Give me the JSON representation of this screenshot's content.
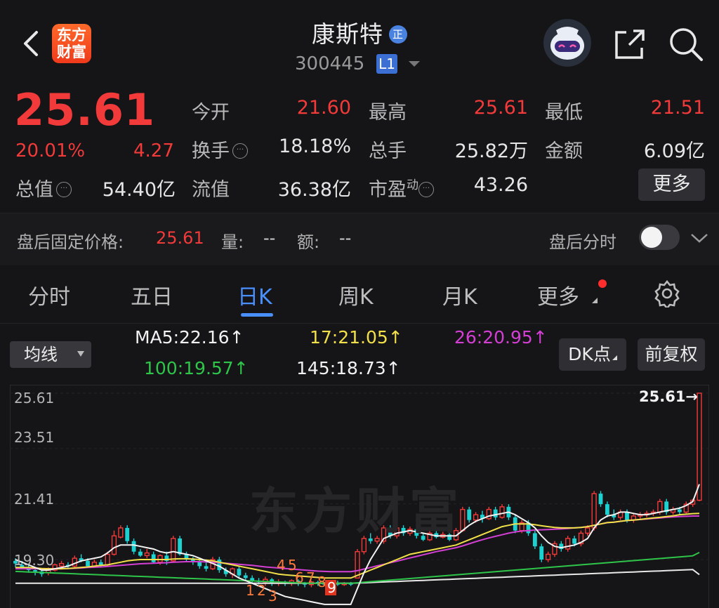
{
  "header": {
    "logo_line1": "东方",
    "logo_line2": "财富",
    "stock_name": "康斯特",
    "badge": "正",
    "code": "300445",
    "level": "L1"
  },
  "quote": {
    "price": "25.61",
    "change_pct": "20.01%",
    "change": "4.27",
    "fields": [
      {
        "label": "今开",
        "value": "21.60",
        "red": true
      },
      {
        "label": "最高",
        "value": "25.61",
        "red": true
      },
      {
        "label": "最低",
        "value": "21.51",
        "red": true
      },
      {
        "label": "换手",
        "value": "18.18%",
        "red": false
      },
      {
        "label": "总手",
        "value": "25.82万",
        "red": false
      },
      {
        "label": "金额",
        "value": "6.09亿",
        "red": false
      },
      {
        "label": "总值",
        "value": "54.40亿",
        "red": false
      },
      {
        "label": "流值",
        "value": "36.38亿",
        "red": false
      },
      {
        "label": "市盈",
        "value": "43.26",
        "red": false
      }
    ],
    "pe_sup": "动",
    "more_label": "更多"
  },
  "afterhours": {
    "fixed_price_label": "盘后固定价格:",
    "fixed_price": "25.61",
    "vol_label": "量:",
    "vol": "--",
    "amt_label": "额:",
    "amt": "--",
    "toggle_label": "盘后分时"
  },
  "tabs": [
    "分时",
    "五日",
    "日K",
    "周K",
    "月K",
    "更多"
  ],
  "active_tab": "日K",
  "ma": {
    "select_label": "均线",
    "items": [
      {
        "text": "MA5:22.16↑",
        "color": "#f2f2f2"
      },
      {
        "text": "17:21.05↑",
        "color": "#f2e04a"
      },
      {
        "text": "26:20.95↑",
        "color": "#d33fd3"
      },
      {
        "text": "100:19.57↑",
        "color": "#2fc44a"
      },
      {
        "text": "145:18.73↑",
        "color": "#f2f2f2"
      }
    ],
    "dk_label": "DK点",
    "fq_label": "前复权"
  },
  "chart_data": {
    "type": "candlestick",
    "y_ticks": [
      "25.61",
      "23.51",
      "21.41",
      "19.30"
    ],
    "ylim": [
      18.6,
      25.61
    ],
    "last_price_label": "25.61→",
    "watermark": "东方财富",
    "signal_numbers": [
      "4",
      "5",
      "1",
      "2",
      "3",
      "6",
      "7",
      "8",
      "9"
    ],
    "colors": {
      "up": "#f23a3a",
      "down": "#1ed1d1",
      "ma5": "#f2f2f2",
      "ma17": "#f2e04a",
      "ma26": "#d33fd3",
      "ma100": "#2fc44a",
      "ma145": "#e8e8e8"
    },
    "candles": [
      [
        19.25,
        19.15,
        19.35,
        19.0
      ],
      [
        19.1,
        19.0,
        19.25,
        18.95
      ],
      [
        19.0,
        18.9,
        19.1,
        18.8
      ],
      [
        18.9,
        18.85,
        19.0,
        18.7
      ],
      [
        18.85,
        18.75,
        18.95,
        18.65
      ],
      [
        18.8,
        18.9,
        19.0,
        18.7
      ],
      [
        18.9,
        19.1,
        19.15,
        18.85
      ],
      [
        19.05,
        19.15,
        19.25,
        18.95
      ],
      [
        19.1,
        19.05,
        19.2,
        18.95
      ],
      [
        19.05,
        19.35,
        19.45,
        19.0
      ],
      [
        19.35,
        19.25,
        19.5,
        19.2
      ],
      [
        19.25,
        19.05,
        19.35,
        19.0
      ],
      [
        19.05,
        19.2,
        19.3,
        19.0
      ],
      [
        19.2,
        19.1,
        19.3,
        19.0
      ],
      [
        19.1,
        19.5,
        19.6,
        19.05
      ],
      [
        19.5,
        20.2,
        20.4,
        19.45
      ],
      [
        20.15,
        20.5,
        20.6,
        20.1
      ],
      [
        20.5,
        20.0,
        20.6,
        19.9
      ],
      [
        20.0,
        19.6,
        20.1,
        19.5
      ],
      [
        19.6,
        19.45,
        19.7,
        19.4
      ],
      [
        19.45,
        19.55,
        19.7,
        19.35
      ],
      [
        19.5,
        19.2,
        19.6,
        19.15
      ],
      [
        19.2,
        19.45,
        19.5,
        19.1
      ],
      [
        19.45,
        19.25,
        19.6,
        19.1
      ],
      [
        19.25,
        20.1,
        20.2,
        19.2
      ],
      [
        20.1,
        19.5,
        20.2,
        19.45
      ],
      [
        19.5,
        19.3,
        19.6,
        19.2
      ],
      [
        19.3,
        19.25,
        19.4,
        19.1
      ],
      [
        19.25,
        19.05,
        19.35,
        18.95
      ],
      [
        19.05,
        18.95,
        19.2,
        18.85
      ],
      [
        18.95,
        19.3,
        19.4,
        18.9
      ],
      [
        19.3,
        18.9,
        19.4,
        18.8
      ],
      [
        18.9,
        18.75,
        19.0,
        18.65
      ],
      [
        18.75,
        18.95,
        19.0,
        18.6
      ],
      [
        18.95,
        18.7,
        19.05,
        18.6
      ],
      [
        18.7,
        18.6,
        18.8,
        18.5
      ],
      [
        18.6,
        18.5,
        18.7,
        18.4
      ],
      [
        18.5,
        18.45,
        18.6,
        18.35
      ],
      [
        18.45,
        18.55,
        18.65,
        18.3
      ],
      [
        18.55,
        18.4,
        18.6,
        18.3
      ],
      [
        18.4,
        18.45,
        18.55,
        18.3
      ],
      [
        18.45,
        18.4,
        18.5,
        18.3
      ],
      [
        18.4,
        18.5,
        18.55,
        18.3
      ],
      [
        18.5,
        18.4,
        18.55,
        18.3
      ],
      [
        18.4,
        18.35,
        18.45,
        18.25
      ],
      [
        18.35,
        18.45,
        18.5,
        18.25
      ],
      [
        18.45,
        18.4,
        18.5,
        18.3
      ],
      [
        18.4,
        18.35,
        18.45,
        18.3
      ],
      [
        18.35,
        18.4,
        18.45,
        18.3
      ],
      [
        18.4,
        18.35,
        18.5,
        18.3
      ],
      [
        18.35,
        18.4,
        18.45,
        18.3
      ],
      [
        18.4,
        18.35,
        18.45,
        18.3
      ],
      [
        18.6,
        19.6,
        19.7,
        18.6
      ],
      [
        19.6,
        20.1,
        20.2,
        19.5
      ],
      [
        20.1,
        20.0,
        20.3,
        19.9
      ],
      [
        20.0,
        20.1,
        20.2,
        19.9
      ],
      [
        20.0,
        20.5,
        20.6,
        19.9
      ],
      [
        20.5,
        20.2,
        20.6,
        20.1
      ],
      [
        20.2,
        20.5,
        20.6,
        20.1
      ],
      [
        20.5,
        20.3,
        20.6,
        20.2
      ],
      [
        20.3,
        20.45,
        20.55,
        20.2
      ],
      [
        20.45,
        20.2,
        20.5,
        20.1
      ],
      [
        20.2,
        20.05,
        20.3,
        20.0
      ],
      [
        20.05,
        20.3,
        20.4,
        20.0
      ],
      [
        20.3,
        20.15,
        20.4,
        20.1
      ],
      [
        20.15,
        20.25,
        20.35,
        20.1
      ],
      [
        20.25,
        20.05,
        20.3,
        20.0
      ],
      [
        20.05,
        20.4,
        20.5,
        20.0
      ],
      [
        20.4,
        21.2,
        21.3,
        20.35
      ],
      [
        21.2,
        20.8,
        21.3,
        20.7
      ],
      [
        20.8,
        21.0,
        21.1,
        20.7
      ],
      [
        21.0,
        20.85,
        21.15,
        20.7
      ],
      [
        20.85,
        21.2,
        21.3,
        20.8
      ],
      [
        21.2,
        20.9,
        21.3,
        20.8
      ],
      [
        20.9,
        21.3,
        21.4,
        20.85
      ],
      [
        21.3,
        20.9,
        21.4,
        20.8
      ],
      [
        20.9,
        20.4,
        21.0,
        20.3
      ],
      [
        20.4,
        20.7,
        20.8,
        20.3
      ],
      [
        20.7,
        20.3,
        20.8,
        20.2
      ],
      [
        20.3,
        19.8,
        20.4,
        19.7
      ],
      [
        19.8,
        19.3,
        19.9,
        19.2
      ],
      [
        19.3,
        19.5,
        19.6,
        19.2
      ],
      [
        19.5,
        19.9,
        20.0,
        19.4
      ],
      [
        19.9,
        19.7,
        20.0,
        19.6
      ],
      [
        19.7,
        20.1,
        20.2,
        19.6
      ],
      [
        20.1,
        19.9,
        20.2,
        19.8
      ],
      [
        19.9,
        20.3,
        20.4,
        19.8
      ],
      [
        20.3,
        20.5,
        20.6,
        20.2
      ],
      [
        20.5,
        21.8,
        21.9,
        20.4
      ],
      [
        21.8,
        21.4,
        21.9,
        21.3
      ],
      [
        21.4,
        21.0,
        21.5,
        20.9
      ],
      [
        21.0,
        20.9,
        21.2,
        20.8
      ],
      [
        20.9,
        21.1,
        21.2,
        20.8
      ],
      [
        21.1,
        20.8,
        21.2,
        20.7
      ],
      [
        20.8,
        20.95,
        21.05,
        20.7
      ],
      [
        20.95,
        21.0,
        21.1,
        20.85
      ],
      [
        21.0,
        21.05,
        21.15,
        20.9
      ],
      [
        21.05,
        21.1,
        21.2,
        20.95
      ],
      [
        21.1,
        21.5,
        21.6,
        21.0
      ],
      [
        21.5,
        21.1,
        21.6,
        21.0
      ],
      [
        21.1,
        21.2,
        21.3,
        21.0
      ],
      [
        21.2,
        21.1,
        21.3,
        21.0
      ],
      [
        21.1,
        21.4,
        21.5,
        21.05
      ],
      [
        21.4,
        21.55,
        21.6,
        21.3
      ],
      [
        21.55,
        25.61,
        25.61,
        21.51
      ]
    ],
    "ma5": [
      19.3,
      19.2,
      19.1,
      19.0,
      18.9,
      18.9,
      18.95,
      19.0,
      19.05,
      19.15,
      19.25,
      19.3,
      19.35,
      19.4,
      19.55,
      19.75,
      19.85,
      19.85,
      19.85,
      19.8,
      19.75,
      19.7,
      19.6,
      19.55,
      19.6,
      19.55,
      19.5,
      19.45,
      19.35,
      19.25,
      19.15,
      19.05,
      18.9,
      18.75,
      18.6,
      18.5,
      18.4,
      18.3,
      18.2,
      18.1,
      18.0,
      17.9,
      17.85,
      17.8,
      17.75,
      17.7,
      17.65,
      17.6,
      17.6,
      17.6,
      17.6,
      17.6,
      18.2,
      18.8,
      19.3,
      19.7,
      20.1,
      20.2,
      20.3,
      20.35,
      20.4,
      20.35,
      20.3,
      20.25,
      20.2,
      20.2,
      20.2,
      20.2,
      20.4,
      20.6,
      20.75,
      20.85,
      20.95,
      21.0,
      21.05,
      21.1,
      21.0,
      20.85,
      20.7,
      20.5,
      20.2,
      19.95,
      19.8,
      19.75,
      19.8,
      19.85,
      19.95,
      20.1,
      20.5,
      20.8,
      20.95,
      21.0,
      21.1,
      21.1,
      21.05,
      21.0,
      21.0,
      21.05,
      21.1,
      21.15,
      21.2,
      21.25,
      21.35,
      21.5,
      22.16
    ],
    "ma17": [
      19.0,
      19.0,
      19.0,
      18.98,
      18.96,
      18.95,
      18.95,
      18.95,
      18.96,
      18.98,
      19.0,
      19.02,
      19.05,
      19.08,
      19.1,
      19.15,
      19.2,
      19.25,
      19.28,
      19.3,
      19.3,
      19.3,
      19.3,
      19.3,
      19.32,
      19.33,
      19.33,
      19.32,
      19.3,
      19.28,
      19.25,
      19.2,
      19.15,
      19.1,
      19.05,
      19.0,
      18.95,
      18.9,
      18.85,
      18.8,
      18.75,
      18.72,
      18.7,
      18.68,
      18.66,
      18.64,
      18.62,
      18.6,
      18.6,
      18.6,
      18.6,
      18.6,
      18.7,
      18.8,
      18.9,
      19.0,
      19.1,
      19.2,
      19.3,
      19.4,
      19.5,
      19.55,
      19.6,
      19.65,
      19.7,
      19.75,
      19.8,
      19.85,
      19.95,
      20.05,
      20.15,
      20.25,
      20.35,
      20.45,
      20.55,
      20.6,
      20.65,
      20.65,
      20.65,
      20.62,
      20.58,
      20.55,
      20.52,
      20.5,
      20.5,
      20.5,
      20.52,
      20.55,
      20.6,
      20.65,
      20.7,
      20.72,
      20.75,
      20.78,
      20.8,
      20.82,
      20.85,
      20.88,
      20.9,
      20.93,
      20.96,
      21.0,
      21.02,
      21.04,
      21.05
    ],
    "ma26": [
      18.95,
      18.95,
      18.95,
      18.95,
      18.95,
      18.95,
      18.95,
      18.95,
      18.96,
      18.97,
      18.98,
      19.0,
      19.01,
      19.02,
      19.04,
      19.06,
      19.08,
      19.1,
      19.12,
      19.14,
      19.15,
      19.16,
      19.17,
      19.18,
      19.2,
      19.21,
      19.22,
      19.22,
      19.22,
      19.21,
      19.2,
      19.18,
      19.16,
      19.14,
      19.12,
      19.1,
      19.08,
      19.05,
      19.02,
      19.0,
      18.98,
      18.96,
      18.94,
      18.92,
      18.9,
      18.88,
      18.86,
      18.85,
      18.84,
      18.84,
      18.84,
      18.84,
      18.88,
      18.94,
      19.0,
      19.06,
      19.12,
      19.18,
      19.24,
      19.3,
      19.36,
      19.42,
      19.48,
      19.54,
      19.6,
      19.65,
      19.7,
      19.75,
      19.82,
      19.9,
      19.98,
      20.05,
      20.12,
      20.18,
      20.24,
      20.3,
      20.35,
      20.38,
      20.4,
      20.42,
      20.43,
      20.44,
      20.45,
      20.46,
      20.48,
      20.5,
      20.52,
      20.55,
      20.6,
      20.65,
      20.7,
      20.72,
      20.75,
      20.78,
      20.8,
      20.82,
      20.84,
      20.86,
      20.88,
      20.9,
      20.92,
      20.93,
      20.94,
      20.95,
      20.95
    ],
    "ma100": [
      18.85,
      18.84,
      18.83,
      18.82,
      18.81,
      18.8,
      18.79,
      18.78,
      18.77,
      18.76,
      18.75,
      18.74,
      18.73,
      18.72,
      18.71,
      18.7,
      18.69,
      18.68,
      18.67,
      18.66,
      18.65,
      18.64,
      18.63,
      18.62,
      18.61,
      18.6,
      18.59,
      18.58,
      18.57,
      18.56,
      18.55,
      18.54,
      18.53,
      18.52,
      18.51,
      18.5,
      18.49,
      18.48,
      18.47,
      18.46,
      18.45,
      18.44,
      18.43,
      18.42,
      18.41,
      18.4,
      18.4,
      18.4,
      18.4,
      18.4,
      18.4,
      18.4,
      18.42,
      18.44,
      18.46,
      18.48,
      18.5,
      18.52,
      18.54,
      18.56,
      18.58,
      18.6,
      18.62,
      18.64,
      18.66,
      18.68,
      18.7,
      18.72,
      18.74,
      18.76,
      18.78,
      18.8,
      18.82,
      18.84,
      18.86,
      18.88,
      18.9,
      18.92,
      18.94,
      18.96,
      18.98,
      19.0,
      19.02,
      19.04,
      19.06,
      19.08,
      19.1,
      19.12,
      19.14,
      19.16,
      19.18,
      19.2,
      19.22,
      19.24,
      19.26,
      19.28,
      19.3,
      19.32,
      19.34,
      19.36,
      19.38,
      19.4,
      19.42,
      19.44,
      19.57
    ],
    "ma145": [
      18.4,
      18.4,
      18.4,
      18.4,
      18.4,
      18.4,
      18.4,
      18.4,
      18.4,
      18.4,
      18.4,
      18.4,
      18.4,
      18.4,
      18.4,
      18.4,
      18.4,
      18.4,
      18.4,
      18.4,
      18.4,
      18.4,
      18.4,
      18.4,
      18.4,
      18.4,
      18.4,
      18.4,
      18.4,
      18.4,
      18.4,
      18.4,
      18.4,
      18.4,
      18.4,
      18.4,
      18.4,
      18.4,
      18.4,
      18.4,
      18.4,
      18.4,
      18.4,
      18.4,
      18.4,
      18.4,
      18.4,
      18.4,
      18.4,
      18.4,
      18.4,
      18.4,
      18.41,
      18.42,
      18.43,
      18.44,
      18.45,
      18.46,
      18.47,
      18.48,
      18.49,
      18.5,
      18.51,
      18.52,
      18.53,
      18.54,
      18.55,
      18.56,
      18.57,
      18.58,
      18.59,
      18.6,
      18.61,
      18.62,
      18.63,
      18.64,
      18.65,
      18.66,
      18.67,
      18.68,
      18.69,
      18.7,
      18.71,
      18.72,
      18.73,
      18.74,
      18.75,
      18.76,
      18.77,
      18.78,
      18.79,
      18.8,
      18.81,
      18.82,
      18.83,
      18.84,
      18.85,
      18.86,
      18.87,
      18.88,
      18.89,
      18.9,
      18.91,
      18.92,
      18.73
    ]
  }
}
